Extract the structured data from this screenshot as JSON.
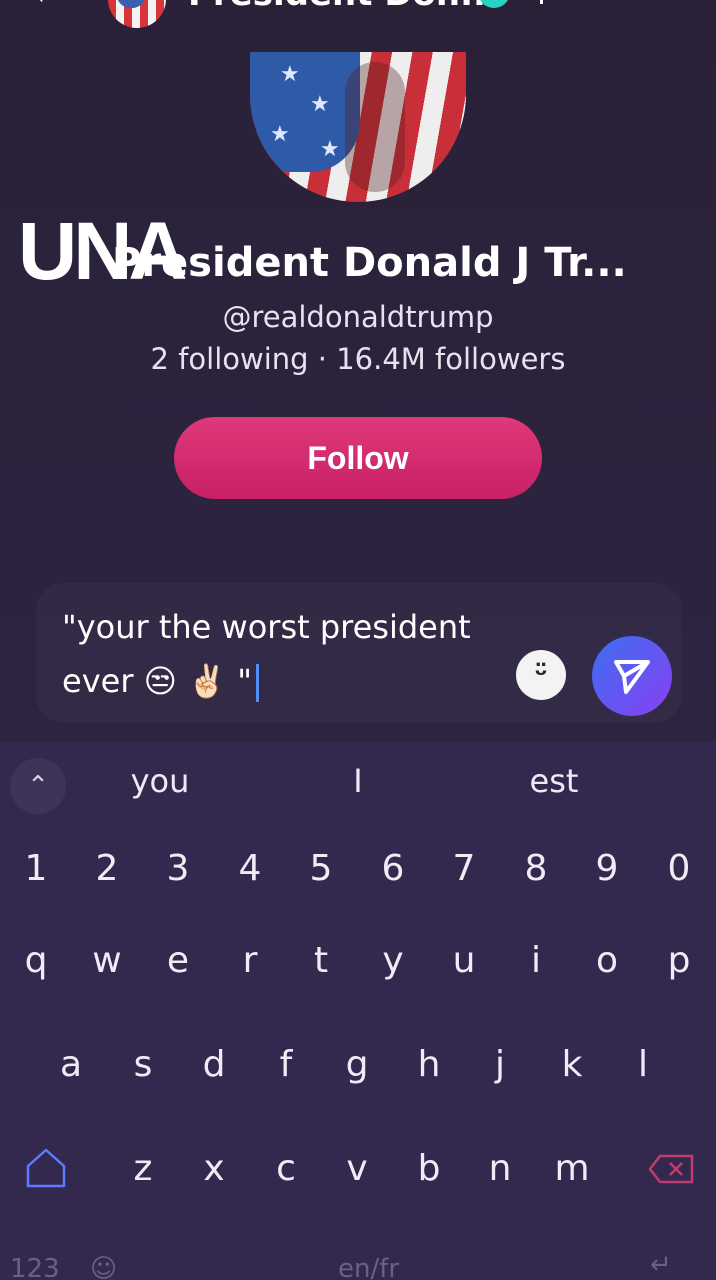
{
  "header": {
    "back_icon": "chevron-left-icon",
    "title": "President Don...",
    "verified_icon": "verified-badge-icon"
  },
  "profile": {
    "overlay_text": "UNA",
    "name": "President Donald J Tr...",
    "handle": "@realdonaldtrump",
    "stats": "2 following · 16.4M followers",
    "follow_label": "Follow"
  },
  "composer": {
    "line1": "\"your the worst president",
    "line2": "ever 😒 ✌🏻 \"",
    "emoji_icon": "wink-emoji-icon",
    "send_icon": "send-arrow-icon"
  },
  "keyboard": {
    "suggestions": [
      "you",
      "I",
      "est"
    ],
    "toggle_glyph": "^",
    "number_row": [
      "1",
      "2",
      "3",
      "4",
      "5",
      "6",
      "7",
      "8",
      "9",
      "0"
    ],
    "row1": [
      "q",
      "w",
      "e",
      "r",
      "t",
      "y",
      "u",
      "i",
      "o",
      "p"
    ],
    "row2": [
      "a",
      "s",
      "d",
      "f",
      "g",
      "h",
      "j",
      "k",
      "l"
    ],
    "row3": [
      "z",
      "x",
      "c",
      "v",
      "b",
      "n",
      "m"
    ],
    "bottom": {
      "numbers": "123",
      "lang": "en/fr"
    }
  }
}
